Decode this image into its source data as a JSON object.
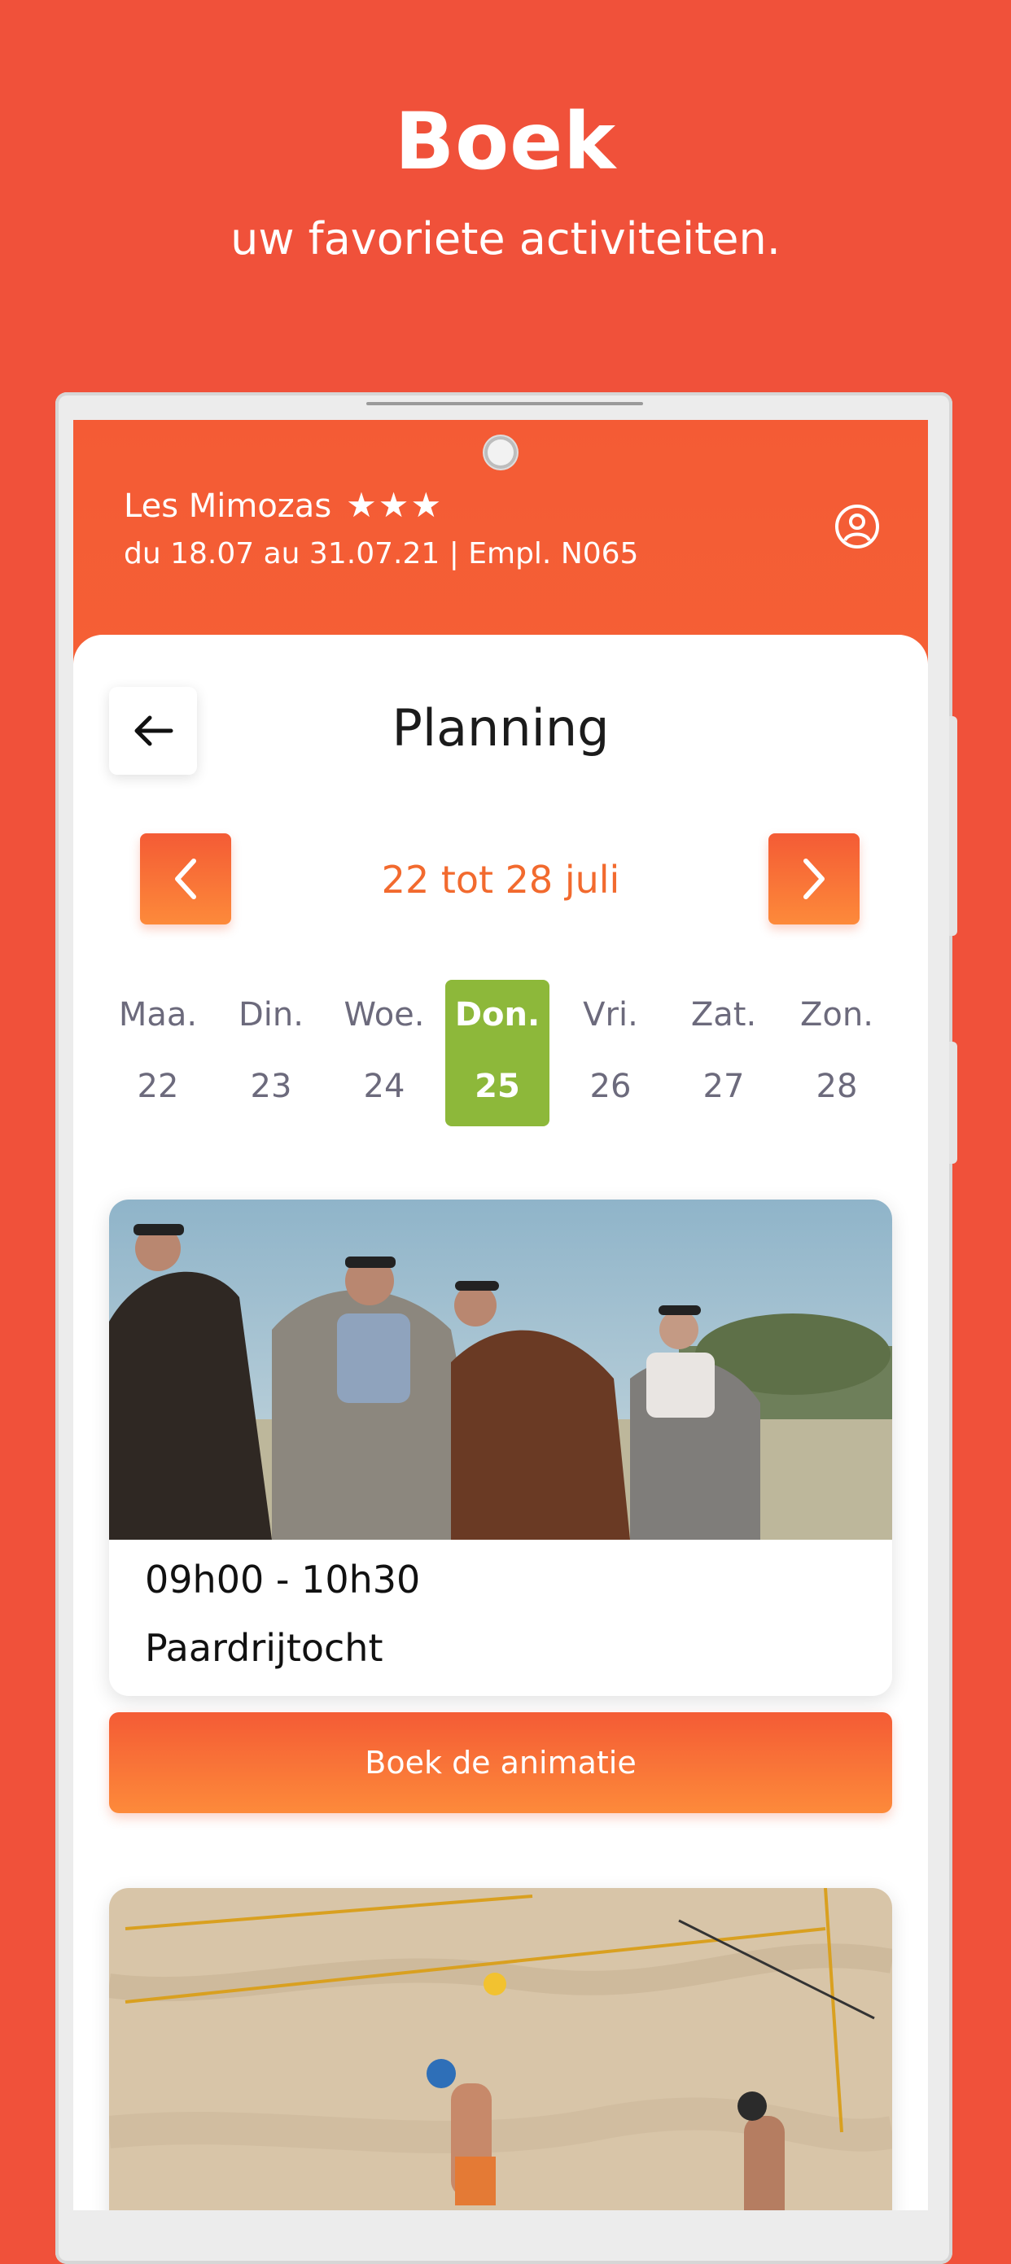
{
  "promo": {
    "title": "Boek",
    "subtitle": "uw favoriete activiteiten."
  },
  "header": {
    "camp_name": "Les Mimozas",
    "stars": "★★★",
    "stay_info": "du 18.07 au 31.07.21  |  Empl. N065",
    "profile_icon": "user-circle-icon"
  },
  "page": {
    "title": "Planning",
    "back_icon": "arrow-left-icon"
  },
  "week": {
    "label": "22 tot 28 juli",
    "prev_icon": "chevron-left-icon",
    "next_icon": "chevron-right-icon"
  },
  "days": [
    {
      "name": "Maa.",
      "num": "22",
      "active": false
    },
    {
      "name": "Din.",
      "num": "23",
      "active": false
    },
    {
      "name": "Woe.",
      "num": "24",
      "active": false
    },
    {
      "name": "Don.",
      "num": "25",
      "active": true
    },
    {
      "name": "Vri.",
      "num": "26",
      "active": false
    },
    {
      "name": "Zat.",
      "num": "27",
      "active": false
    },
    {
      "name": "Zon.",
      "num": "28",
      "active": false
    }
  ],
  "activities": [
    {
      "time": "09h00 - 10h30",
      "name": "Paardrijtocht",
      "photo": "horse-riders-photo",
      "book_label": "Boek de animatie"
    },
    {
      "photo": "beach-volleyball-photo"
    }
  ],
  "colors": {
    "background": "#F0513A",
    "accent": "#F45B35",
    "active_day": "#8DB83A",
    "day_text": "#6C6A7C"
  }
}
